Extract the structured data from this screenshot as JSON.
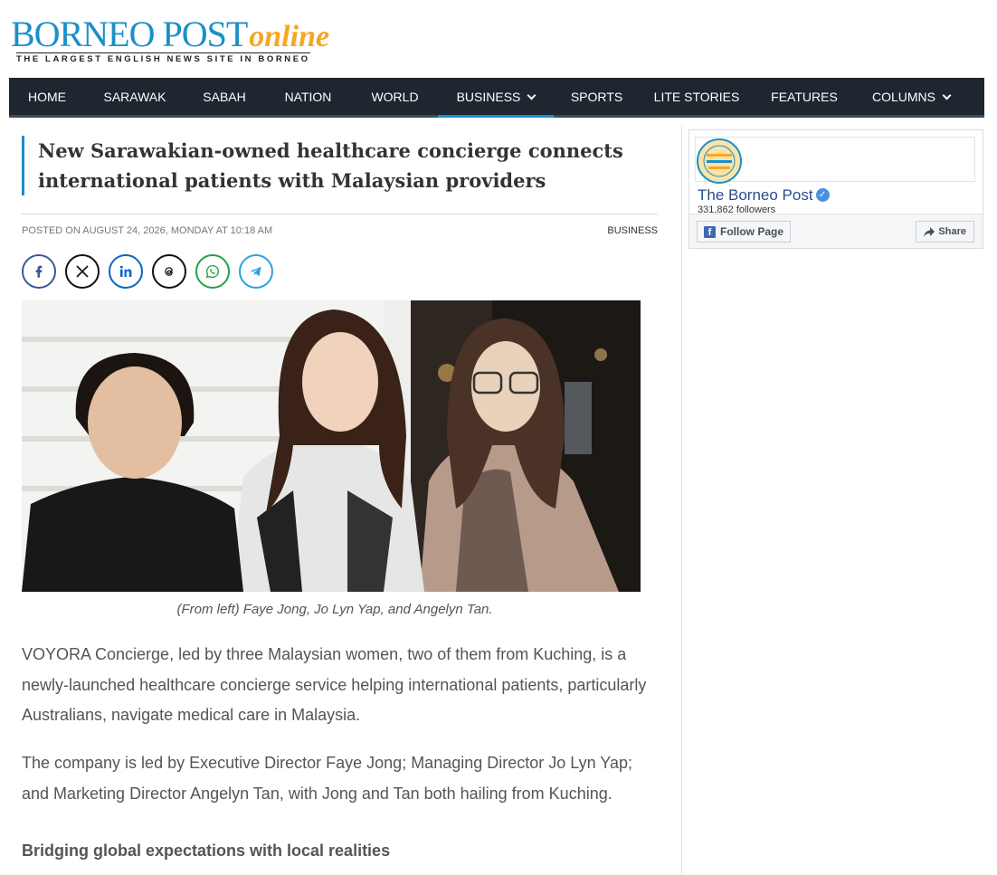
{
  "logo": {
    "main": "BORNEO POST",
    "online": "online",
    "tagline": "THE LARGEST ENGLISH NEWS SITE IN BORNEO"
  },
  "nav": {
    "items": [
      {
        "label": "HOME"
      },
      {
        "label": "SARAWAK"
      },
      {
        "label": "SABAH"
      },
      {
        "label": "NATION"
      },
      {
        "label": "WORLD"
      },
      {
        "label": "BUSINESS"
      },
      {
        "label": "SPORTS"
      },
      {
        "label": "LITE STORIES"
      },
      {
        "label": "FEATURES"
      },
      {
        "label": "COLUMNS"
      }
    ],
    "active": "BUSINESS"
  },
  "article": {
    "headline": "New Sarawakian-owned healthcare concierge connects international patients with Malaysian providers",
    "posted": "POSTED ON AUGUST 24, 2026, MONDAY AT 10:18 AM",
    "category": "BUSINESS",
    "caption": "(From left) Faye Jong, Jo Lyn Yap, and Angelyn Tan.",
    "paragraphs": [
      "VOYORA Concierge, led by three Malaysian women, two of them from Kuching, is a newly-launched healthcare concierge service helping international patients, particularly Australians, navigate medical care in Malaysia.",
      "The company is led by Executive Director Faye Jong; Managing Director Jo Lyn Yap; and Marketing Director Angelyn Tan, with Jong and Tan both hailing from Kuching."
    ],
    "subhead": "Bridging global expectations with local realities"
  },
  "share": {
    "icons": [
      "facebook-icon",
      "x-icon",
      "linkedin-icon",
      "threads-icon",
      "whatsapp-icon",
      "telegram-icon"
    ],
    "colors": {
      "facebook": "#3b5998",
      "x": "#111111",
      "linkedin": "#0a66c2",
      "threads": "#111111",
      "whatsapp": "#25a244",
      "telegram": "#2aa3d8"
    }
  },
  "facebook_widget": {
    "page_name": "The Borneo Post",
    "followers": "331,862 followers",
    "follow_label": "Follow Page",
    "share_label": "Share"
  },
  "colors": {
    "brand_blue": "#1a8fc9",
    "brand_orange": "#f5a623",
    "nav_bg": "#1e2730"
  }
}
